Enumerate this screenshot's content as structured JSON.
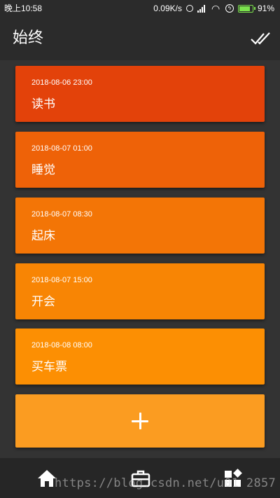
{
  "status_bar": {
    "time": "晚上10:58",
    "network_speed": "0.09K/s",
    "battery_percent": "91%",
    "icons": [
      "alarm-icon",
      "signal-icon",
      "wifi-icon",
      "charge-icon",
      "battery-icon"
    ]
  },
  "app_bar": {
    "title": "始终",
    "action_icon": "done-all-icon"
  },
  "tasks": [
    {
      "time": "2018-08-06 23:00",
      "label": "读书",
      "color": "#e3420a"
    },
    {
      "time": "2018-08-07 01:00",
      "label": "睡觉",
      "color": "#ee6208"
    },
    {
      "time": "2018-08-07 08:30",
      "label": "起床",
      "color": "#f37506"
    },
    {
      "time": "2018-08-07 15:00",
      "label": "开会",
      "color": "#f88504"
    },
    {
      "time": "2018-08-08 08:00",
      "label": "买车票",
      "color": "#fc8f03"
    }
  ],
  "add_button": {
    "icon": "plus-icon",
    "color": "#fb9c21"
  },
  "bottom_nav": {
    "items": [
      {
        "icon": "home-icon"
      },
      {
        "icon": "briefcase-icon"
      },
      {
        "icon": "widgets-icon"
      }
    ]
  },
  "watermark": "https://blog.csdn.net/u01  2857"
}
